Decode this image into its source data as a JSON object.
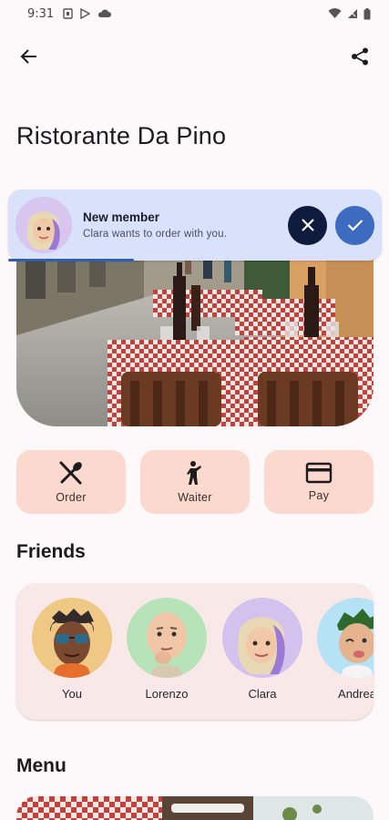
{
  "status": {
    "time": "9:31"
  },
  "toolbar": {
    "back_icon": "arrow-back-icon",
    "share_icon": "share-icon"
  },
  "page": {
    "title": "Ristorante Da Pino"
  },
  "notification": {
    "title": "New member",
    "message": "Clara wants to order with you.",
    "progress": 0.33,
    "colors": {
      "background": "#d9e1fb",
      "dismiss": "#0f1b3d",
      "accept": "#3c6bc0"
    }
  },
  "actions": [
    {
      "label": "Order",
      "icon": "restaurant-icon"
    },
    {
      "label": "Waiter",
      "icon": "waiter-icon"
    },
    {
      "label": "Pay",
      "icon": "credit-card-icon"
    }
  ],
  "friends": {
    "title": "Friends",
    "items": [
      {
        "name": "You",
        "color": "#f0c886"
      },
      {
        "name": "Lorenzo",
        "color": "#b7e3b8"
      },
      {
        "name": "Clara",
        "color": "#d3c2ee"
      },
      {
        "name": "Andrea",
        "color": "#b5e2f4"
      }
    ]
  },
  "menu": {
    "title": "Menu"
  },
  "colors": {
    "background": "#fdf8f9",
    "action_tile": "#fbd9cf",
    "friends_card": "#f8e9e8"
  }
}
